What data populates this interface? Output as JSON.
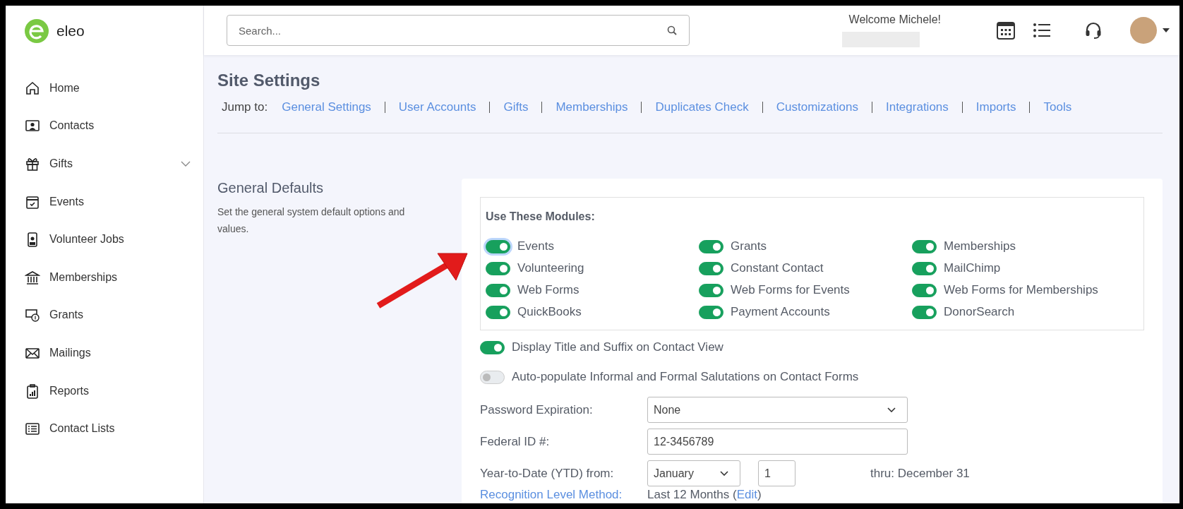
{
  "brand": {
    "name": "eleo"
  },
  "sidebar": {
    "items": [
      {
        "label": "Home"
      },
      {
        "label": "Contacts"
      },
      {
        "label": "Gifts",
        "expanded": false
      },
      {
        "label": "Events"
      },
      {
        "label": "Volunteer Jobs"
      },
      {
        "label": "Memberships"
      },
      {
        "label": "Grants"
      },
      {
        "label": "Mailings"
      },
      {
        "label": "Reports"
      },
      {
        "label": "Contact Lists"
      }
    ]
  },
  "topbar": {
    "search": {
      "placeholder": "Search..."
    },
    "welcome": "Welcome Michele!"
  },
  "page": {
    "title": "Site Settings",
    "jump_label": "Jump to:",
    "jump_links": [
      "General Settings",
      "User Accounts",
      "Gifts",
      "Memberships",
      "Duplicates Check",
      "Customizations",
      "Integrations",
      "Imports",
      "Tools"
    ]
  },
  "section": {
    "title": "General Defaults",
    "description": "Set the general system default options and values."
  },
  "modules": {
    "heading": "Use These Modules:",
    "items": [
      {
        "label": "Events",
        "on": true,
        "focused": true
      },
      {
        "label": "Grants",
        "on": true,
        "focused": false
      },
      {
        "label": "Memberships",
        "on": true,
        "focused": false
      },
      {
        "label": "Volunteering",
        "on": true,
        "focused": false
      },
      {
        "label": "Constant Contact",
        "on": true,
        "focused": false
      },
      {
        "label": "MailChimp",
        "on": true,
        "focused": false
      },
      {
        "label": "Web Forms",
        "on": true,
        "focused": false
      },
      {
        "label": "Web Forms for Events",
        "on": true,
        "focused": false
      },
      {
        "label": "Web Forms for Memberships",
        "on": true,
        "focused": false
      },
      {
        "label": "QuickBooks",
        "on": true,
        "focused": false
      },
      {
        "label": "Payment Accounts",
        "on": true,
        "focused": false
      },
      {
        "label": "DonorSearch",
        "on": true,
        "focused": false
      }
    ]
  },
  "toggles": [
    {
      "label": "Display Title and Suffix on Contact View",
      "on": true
    },
    {
      "label": "Auto-populate Informal and Formal Salutations on Contact Forms",
      "on": false
    }
  ],
  "fields": [
    {
      "kind": "select",
      "label": "Password Expiration:",
      "value": "None"
    },
    {
      "kind": "text",
      "label": "Federal ID #:",
      "value": "12-3456789"
    },
    {
      "kind": "ytd",
      "label": "Year-to-Date (YTD) from:",
      "month": "January",
      "day": "1",
      "note": "thru: December 31"
    }
  ],
  "recognition": {
    "label": "Recognition Level Method:",
    "value": "Last 12 Months",
    "open": "(",
    "edit": "Edit",
    "close": ")"
  }
}
